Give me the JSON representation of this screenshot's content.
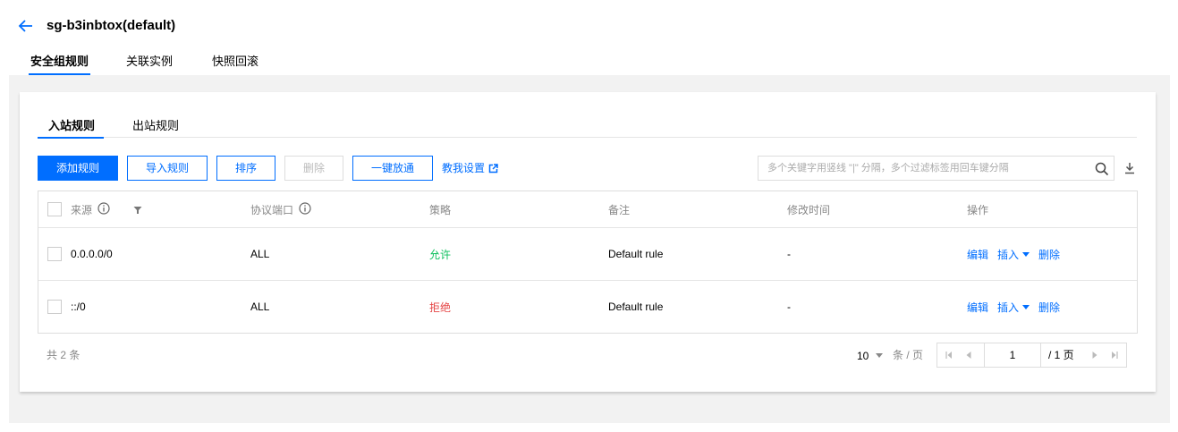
{
  "header": {
    "title": "sg-b3inbtox(default)",
    "tabs": [
      {
        "label": "安全组规则",
        "active": true
      },
      {
        "label": "关联实例",
        "active": false
      },
      {
        "label": "快照回滚",
        "active": false
      }
    ]
  },
  "rules": {
    "tabs": [
      {
        "label": "入站规则",
        "active": true
      },
      {
        "label": "出站规则",
        "active": false
      }
    ],
    "toolbar": {
      "add_label": "添加规则",
      "import_label": "导入规则",
      "sort_label": "排序",
      "delete_label": "删除",
      "allow_all_label": "一键放通",
      "guide_label": "教我设置",
      "search_placeholder": "多个关键字用竖线 \"|\" 分隔，多个过滤标签用回车键分隔"
    },
    "columns": {
      "source": "来源",
      "port": "协议端口",
      "policy": "策略",
      "note": "备注",
      "time": "修改时间",
      "ops": "操作"
    },
    "rows": [
      {
        "source": "0.0.0.0/0",
        "port": "ALL",
        "policy": "允许",
        "note": "Default rule",
        "time": "-"
      },
      {
        "source": "::/0",
        "port": "ALL",
        "policy": "拒绝",
        "note": "Default rule",
        "time": "-"
      }
    ],
    "row_actions": {
      "edit": "编辑",
      "insert": "插入",
      "delete": "删除"
    },
    "footer": {
      "total": "共 2 条",
      "page_size": "10",
      "per_page": "条 / 页",
      "current_page": "1",
      "total_pages": "/ 1 页"
    }
  },
  "colors": {
    "accent": "#006eff",
    "allow": "#0abf5b",
    "deny": "#e54545",
    "background": "#f2f2f2"
  },
  "icons": [
    "back-arrow-icon",
    "info-icon",
    "filter-icon",
    "external-link-icon",
    "search-icon",
    "download-icon",
    "caret-down-icon",
    "first-page-icon",
    "prev-page-icon",
    "next-page-icon",
    "last-page-icon"
  ]
}
